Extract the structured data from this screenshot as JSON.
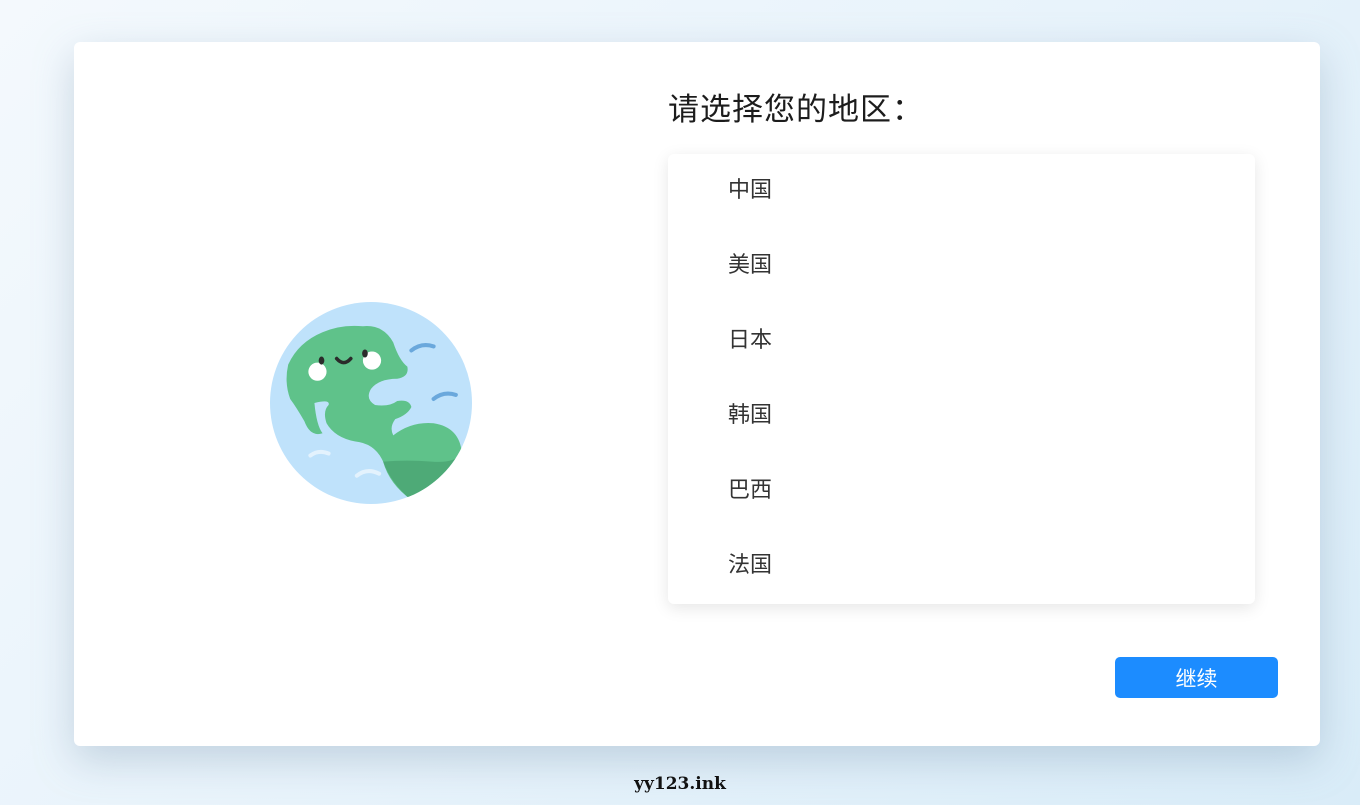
{
  "dialog": {
    "title": "请选择您的地区："
  },
  "regions": [
    {
      "label": "中国"
    },
    {
      "label": "美国"
    },
    {
      "label": "日本"
    },
    {
      "label": "韩国"
    },
    {
      "label": "巴西"
    },
    {
      "label": "法国"
    }
  ],
  "actions": {
    "continue_label": "继续"
  },
  "watermark": "yy123.ink",
  "colors": {
    "accent": "#1c8cff",
    "globe_ocean": "#bfe2fb",
    "globe_land": "#5fc28a"
  },
  "icons": {
    "illustration": "smiling-globe-icon"
  }
}
